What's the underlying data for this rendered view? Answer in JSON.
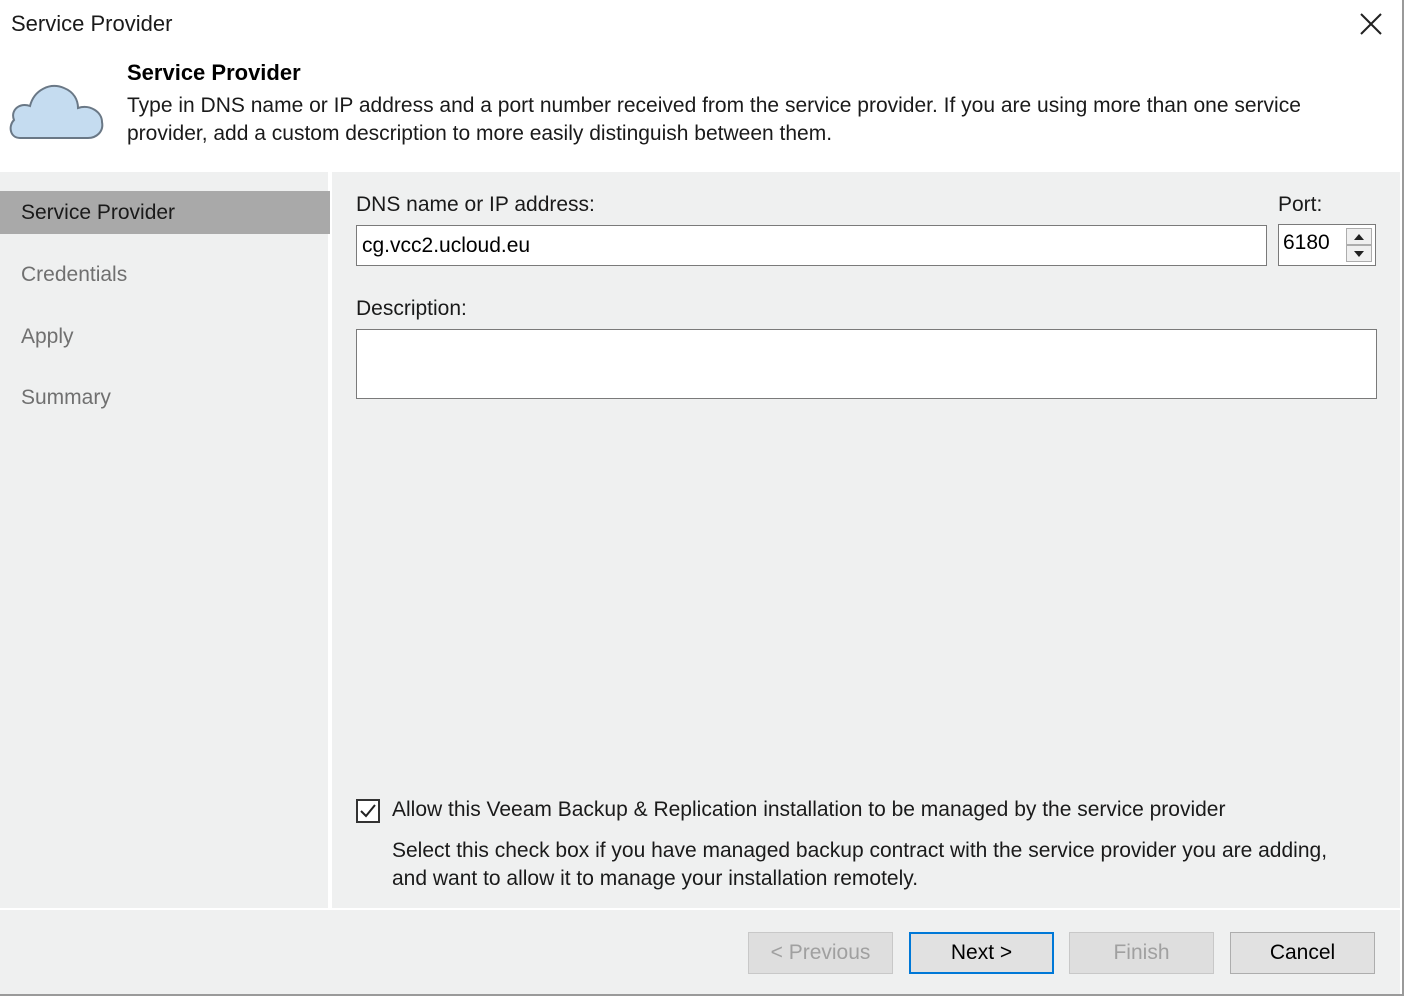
{
  "window": {
    "title": "Service Provider"
  },
  "header": {
    "title": "Service Provider",
    "description": "Type in DNS name or IP address and a port number received from the service provider. If you are using more than one service provider, add a custom description to more easily distinguish between them.",
    "icon": "cloud-icon"
  },
  "sidebar": {
    "steps": [
      {
        "label": "Service Provider",
        "active": true
      },
      {
        "label": "Credentials",
        "active": false
      },
      {
        "label": "Apply",
        "active": false
      },
      {
        "label": "Summary",
        "active": false
      }
    ]
  },
  "form": {
    "dns_label": "DNS name or IP address:",
    "dns_value": "cg.vcc2.ucloud.eu",
    "port_label": "Port:",
    "port_value": "6180",
    "description_label": "Description:",
    "description_value": "",
    "managed_checkbox_label": "Allow this Veeam Backup & Replication installation to be managed by the service provider",
    "managed_checkbox_checked": true,
    "managed_help": "Select this check box if you have managed backup contract with the service provider you are adding, and want to allow it to manage your installation remotely."
  },
  "footer": {
    "previous_label": "< Previous",
    "next_label": "Next >",
    "finish_label": "Finish",
    "cancel_label": "Cancel"
  },
  "colors": {
    "panel_bg": "#eff0f0",
    "active_step_bg": "#a9a9a9",
    "default_button_border": "#0078d7",
    "cloud_fill": "#c5dcf0"
  }
}
